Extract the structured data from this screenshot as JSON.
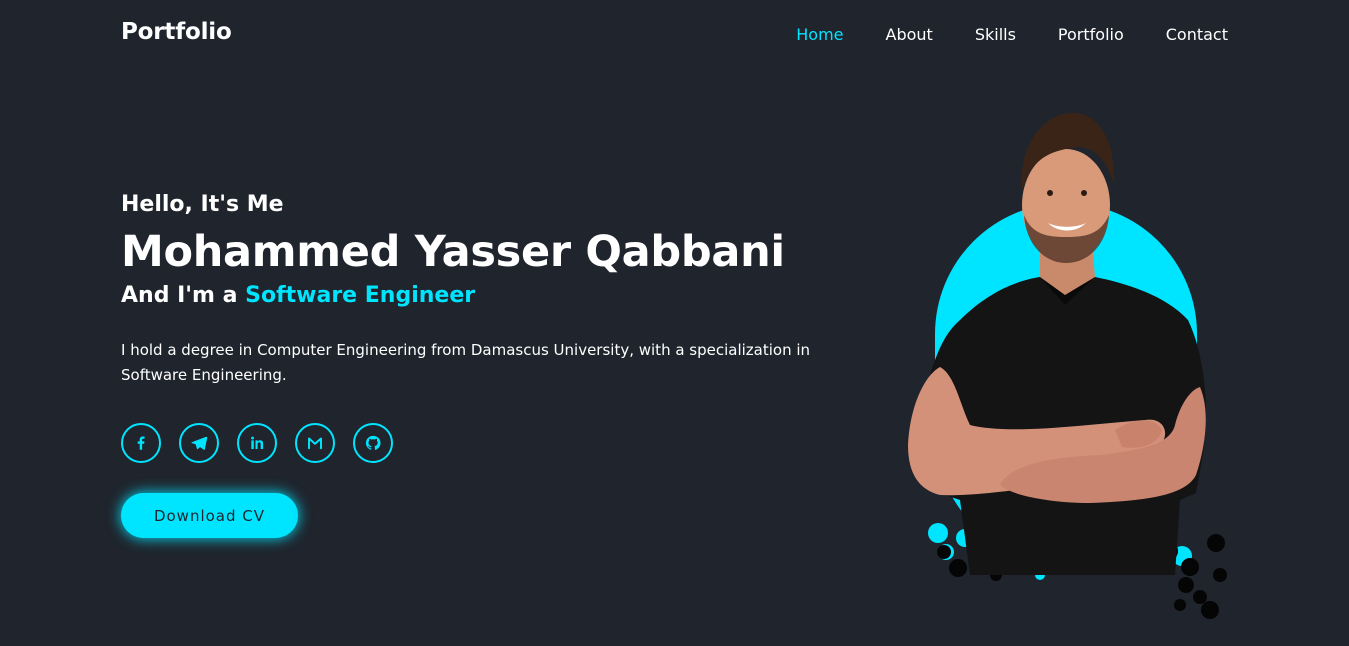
{
  "header": {
    "logo": "Portfolio",
    "nav": [
      {
        "label": "Home",
        "active": true
      },
      {
        "label": "About",
        "active": false
      },
      {
        "label": "Skills",
        "active": false
      },
      {
        "label": "Portfolio",
        "active": false
      },
      {
        "label": "Contact",
        "active": false
      }
    ]
  },
  "hero": {
    "greeting": "Hello, It's Me",
    "name": "Mohammed Yasser Qabbani",
    "role_prefix": "And I'm a ",
    "role": "Software Engineer",
    "description": "I hold a degree in Computer Engineering from Damascus University, with a specialization in Software Engineering.",
    "socials": [
      {
        "icon": "facebook-icon"
      },
      {
        "icon": "telegram-icon"
      },
      {
        "icon": "linkedin-icon"
      },
      {
        "icon": "gmail-icon"
      },
      {
        "icon": "github-icon"
      }
    ],
    "cta_label": "Download CV"
  },
  "colors": {
    "background": "#1f242d",
    "accent": "#00e5ff",
    "text": "#ffffff"
  }
}
